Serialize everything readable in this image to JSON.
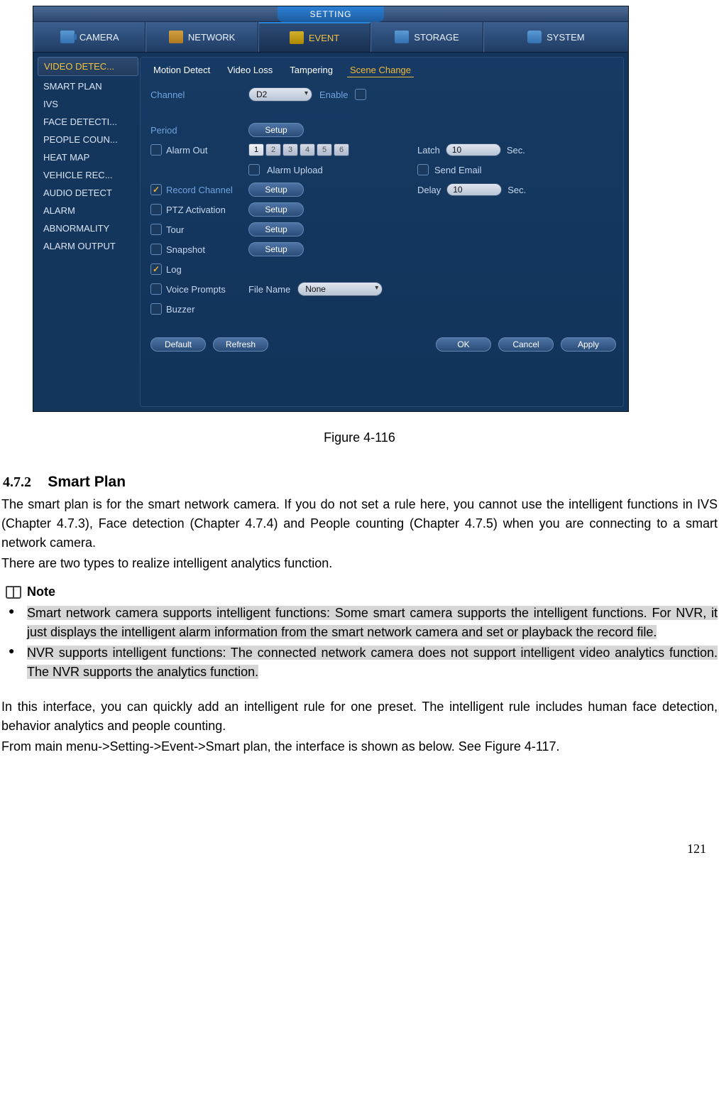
{
  "dialog": {
    "title": "SETTING",
    "mainnav": [
      {
        "label": "CAMERA",
        "icon": "camera"
      },
      {
        "label": "NETWORK",
        "icon": "network"
      },
      {
        "label": "EVENT",
        "icon": "event"
      },
      {
        "label": "STORAGE",
        "icon": "storage"
      },
      {
        "label": "SYSTEM",
        "icon": "system"
      }
    ],
    "mainnav_active": 2,
    "sidebar": [
      "VIDEO DETEC...",
      "SMART PLAN",
      "IVS",
      "FACE DETECTI...",
      "PEOPLE COUN...",
      "HEAT MAP",
      "VEHICLE REC...",
      "AUDIO DETECT",
      "ALARM",
      "ABNORMALITY",
      "ALARM OUTPUT"
    ],
    "sidebar_active": 0,
    "subtabs": [
      "Motion Detect",
      "Video Loss",
      "Tampering",
      "Scene Change"
    ],
    "subtab_active": 3,
    "form": {
      "channel_label": "Channel",
      "channel_value": "D2",
      "enable_label": "Enable",
      "enable_checked": false,
      "period_label": "Period",
      "setup_label": "Setup",
      "alarm_out_label": "Alarm Out",
      "alarm_out_checked": false,
      "alarm_out_options": [
        "1",
        "2",
        "3",
        "4",
        "5",
        "6"
      ],
      "alarm_out_active": 0,
      "latch_label": "Latch",
      "latch_value": "10",
      "sec_label": "Sec.",
      "alarm_upload_label": "Alarm Upload",
      "alarm_upload_checked": false,
      "send_email_label": "Send Email",
      "send_email_checked": false,
      "record_channel_label": "Record Channel",
      "record_channel_checked": true,
      "delay_label": "Delay",
      "delay_value": "10",
      "ptz_label": "PTZ Activation",
      "ptz_checked": false,
      "tour_label": "Tour",
      "tour_checked": false,
      "snapshot_label": "Snapshot",
      "snapshot_checked": false,
      "log_label": "Log",
      "log_checked": true,
      "voice_label": "Voice Prompts",
      "voice_checked": false,
      "filename_label": "File Name",
      "filename_value": "None",
      "buzzer_label": "Buzzer",
      "buzzer_checked": false
    },
    "footer": {
      "default": "Default",
      "refresh": "Refresh",
      "ok": "OK",
      "cancel": "Cancel",
      "apply": "Apply"
    }
  },
  "doc": {
    "figure_caption": "Figure 4-116",
    "section_number": "4.7.2",
    "section_title": "Smart Plan",
    "p1": "The smart plan is for the smart network camera. If you do not set a rule here, you cannot use the intelligent functions in IVS (Chapter 4.7.3), Face detection (Chapter 4.7.4) and People counting (Chapter 4.7.5) when you are connecting to a smart network camera.",
    "p2": "There are two types to realize intelligent analytics function.",
    "note_label": "Note",
    "b1_a": "Smart network camera supports intelligent functions: Some smart camera supports the intelligent functions. For NVR, it just displays the intelligent alarm information from the smart network camera and set or playback the record file.",
    "b2_a": "NVR supports intelligent functions: The connected network camera does not support intelligent video analytics function. The NVR supports the analytics function.",
    "p3": "In this interface, you can quickly add an intelligent rule for one preset. The intelligent rule includes human face detection, behavior analytics and people counting.",
    "p4": "From main menu->Setting->Event->Smart plan, the interface is shown as below. See Figure 4-117.",
    "page_number": "121"
  }
}
